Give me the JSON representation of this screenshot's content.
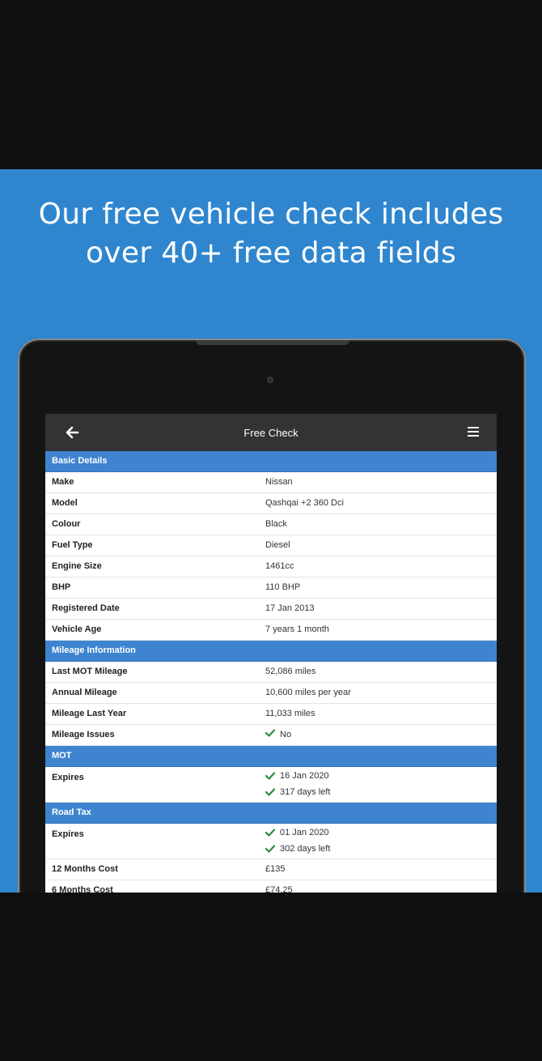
{
  "promo": {
    "headline_line1": "Our free vehicle check includes",
    "headline_line2": "over 40+ free data fields"
  },
  "app": {
    "title": "Free Check",
    "accent_color": "#3f84cf",
    "check_color": "#2e8b3e"
  },
  "sections": {
    "basic": {
      "title": "Basic Details",
      "rows": [
        {
          "label": "Make",
          "value": "Nissan"
        },
        {
          "label": "Model",
          "value": "Qashqai +2 360 Dci"
        },
        {
          "label": "Colour",
          "value": "Black"
        },
        {
          "label": "Fuel Type",
          "value": "Diesel"
        },
        {
          "label": "Engine Size",
          "value": "1461cc"
        },
        {
          "label": "BHP",
          "value": "110 BHP"
        },
        {
          "label": "Registered Date",
          "value": "17 Jan 2013"
        },
        {
          "label": "Vehicle Age",
          "value": "7 years 1 month"
        }
      ]
    },
    "mileage": {
      "title": "Mileage Information",
      "rows": [
        {
          "label": "Last MOT Mileage",
          "value": "52,086 miles"
        },
        {
          "label": "Annual Mileage",
          "value": "10,600 miles per year"
        },
        {
          "label": "Mileage Last Year",
          "value": "11,033 miles"
        },
        {
          "label": "Mileage Issues",
          "value": "No"
        }
      ]
    },
    "mot": {
      "title": "MOT",
      "expires_label": "Expires",
      "expires_date": "16 Jan 2020",
      "expires_days": "317 days left"
    },
    "tax": {
      "title": "Road Tax",
      "expires_label": "Expires",
      "expires_date": "01 Jan 2020",
      "expires_days": "302 days left",
      "rows": [
        {
          "label": "12 Months Cost",
          "value": "£135"
        },
        {
          "label": "6 Months Cost",
          "value": "£74.25"
        }
      ]
    }
  }
}
